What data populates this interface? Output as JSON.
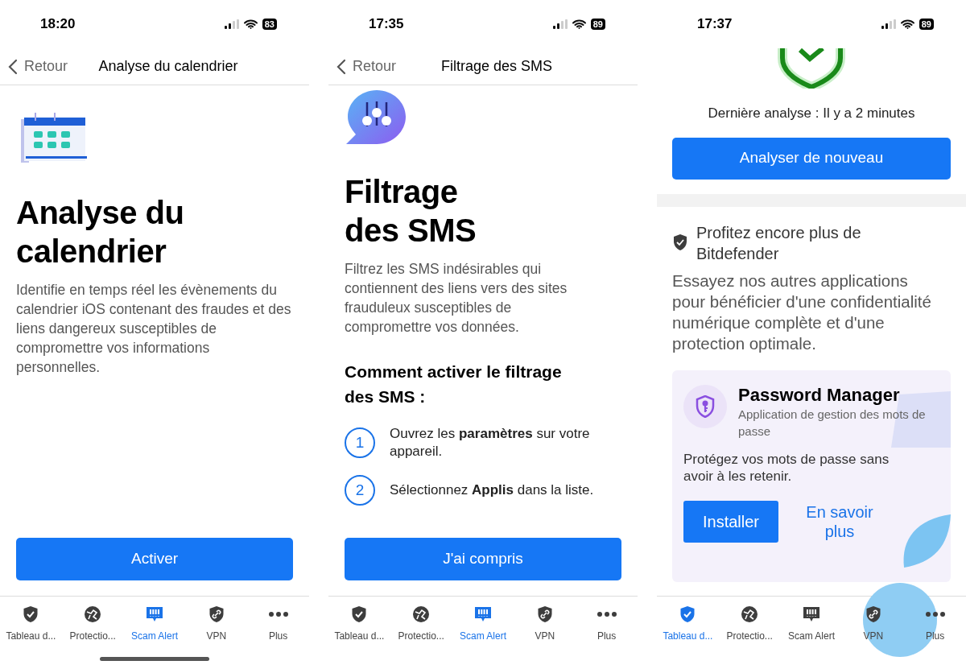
{
  "screens": [
    {
      "kind": "feature",
      "status_bar": {
        "time": "18:20",
        "battery": "83"
      },
      "nav_bar": {
        "back_label": "Retour",
        "title": "Analyse du calendrier"
      },
      "header_icon": {
        "kind": "calendar"
      },
      "heading_lines": [
        "Analyse du",
        "calendrier"
      ],
      "description": "Identifie en temps réel les évènements du calendrier iOS contenant des fraudes et des liens dangereux susceptibles de compromettre vos informations personnelles.",
      "primary_button": "Activer",
      "tab_bar": [
        {
          "kind": "dashboard",
          "label": "Tableau d...",
          "selected": false
        },
        {
          "kind": "protection",
          "label": "Protectio...",
          "selected": false
        },
        {
          "kind": "scam",
          "label": "Scam Alert",
          "selected": true
        },
        {
          "kind": "vpn",
          "label": "VPN",
          "selected": false
        },
        {
          "kind": "more",
          "label": "Plus",
          "selected": false
        }
      ]
    },
    {
      "kind": "feature",
      "status_bar": {
        "time": "17:35",
        "battery": "89"
      },
      "nav_bar": {
        "back_label": "Retour",
        "title": "Filtrage des SMS"
      },
      "header_icon": {
        "kind": "sms"
      },
      "heading_lines": [
        "Filtrage",
        "des SMS"
      ],
      "description": "Filtrez les SMS indésirables qui contiennent des liens vers des sites frauduleux susceptibles de compromettre vos données.",
      "steps_title": "Comment activer le filtrage des SMS :",
      "steps": [
        {
          "number": "1",
          "text": "Ouvrez les **paramètres** sur votre appareil."
        },
        {
          "number": "2",
          "text": "Sélectionnez **Applis** dans la liste."
        }
      ],
      "primary_button": "J'ai compris",
      "tab_bar": [
        {
          "kind": "dashboard",
          "label": "Tableau d...",
          "selected": false
        },
        {
          "kind": "protection",
          "label": "Protectio...",
          "selected": false
        },
        {
          "kind": "scam",
          "label": "Scam Alert",
          "selected": true
        },
        {
          "kind": "vpn",
          "label": "VPN",
          "selected": false
        },
        {
          "kind": "more",
          "label": "Plus",
          "selected": false
        }
      ]
    },
    {
      "kind": "dashboard",
      "status_bar": {
        "time": "17:37",
        "battery": "89"
      },
      "last_scan": "Dernière analyse : Il y a 2 minutes",
      "primary_button": "Analyser de nouveau",
      "promo": {
        "title": "Profitez encore plus de Bitdefender",
        "description": "Essayez nos autres applications pour bénéficier d'une confidentialité numérique complète et d'une protection optimale.",
        "card": {
          "name": "Password Manager",
          "subtitle": "Application de gestion des mots de passe",
          "text": "Protégez vos mots de passe sans avoir à les retenir.",
          "install_button": "Installer",
          "learn_more_link": "En savoir plus"
        }
      },
      "tab_bar": [
        {
          "kind": "dashboard",
          "label": "Tableau d...",
          "selected": true
        },
        {
          "kind": "protection",
          "label": "Protectio...",
          "selected": false
        },
        {
          "kind": "scam",
          "label": "Scam Alert",
          "selected": false
        },
        {
          "kind": "vpn",
          "label": "VPN",
          "selected": false
        },
        {
          "kind": "more",
          "label": "Plus",
          "selected": false
        }
      ]
    }
  ]
}
